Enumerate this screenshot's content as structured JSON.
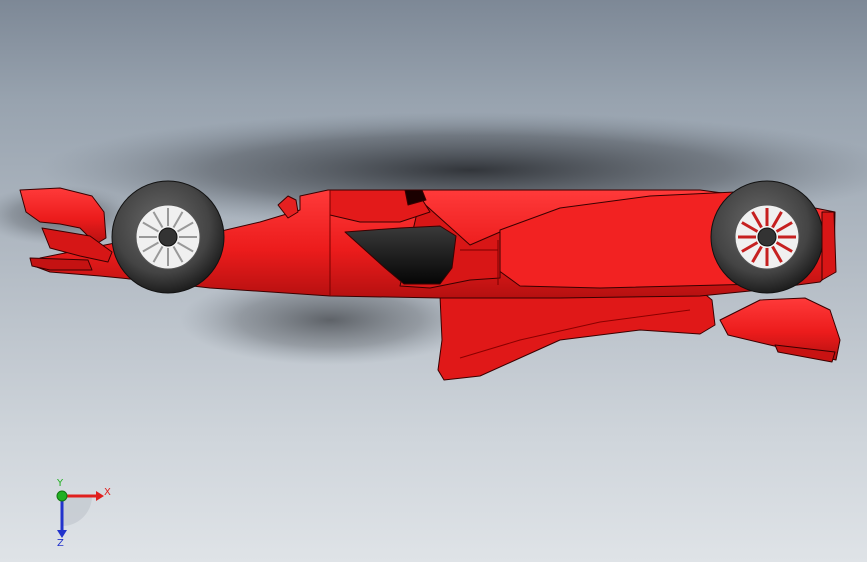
{
  "viewport": {
    "background_top": "#7d8896",
    "background_bottom": "#dfe3e7"
  },
  "model": {
    "body_color": "#ec1c1c",
    "body_shadow": "#b51010",
    "edge_color": "#3a0000",
    "tire_color": "#3c3c3c",
    "rim_color": "#d8d8d8"
  },
  "triad": {
    "x_label": "X",
    "y_label": "Y",
    "z_label": "Z",
    "x_color": "#e0201e",
    "y_color": "#22b022",
    "z_color": "#2233cc"
  }
}
